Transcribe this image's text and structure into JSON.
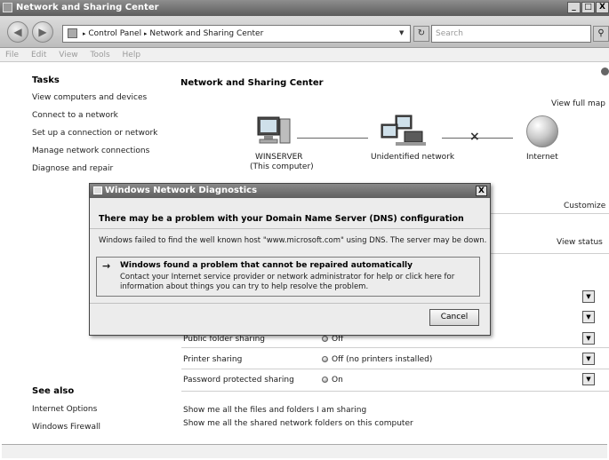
{
  "window": {
    "title": "Network and Sharing Center",
    "buttons": [
      "_",
      "□",
      "X"
    ]
  },
  "address": {
    "crumb_sep": "▸",
    "crumbs": [
      "Control Panel",
      "Network and Sharing Center"
    ],
    "search_placeholder": "Search",
    "search_icon": "magnifier-icon"
  },
  "menu": {
    "items": [
      "File",
      "Edit",
      "View",
      "Tools",
      "Help"
    ]
  },
  "sidebar": {
    "tasks_title": "Tasks",
    "tasks": [
      "View computers and devices",
      "Connect to a network",
      "Set up a connection or network",
      "Manage network connections",
      "Diagnose and repair"
    ],
    "see_also_title": "See also",
    "see_also": [
      "Internet Options",
      "Windows Firewall"
    ]
  },
  "main": {
    "title": "Network and Sharing Center",
    "view_full_map": "View full map",
    "map": {
      "computer_label": "WINSERVER",
      "computer_sub": "(This computer)",
      "network_label": "Unidentified network",
      "internet_label": "Internet",
      "broken_link": "×"
    },
    "customize": "Customize",
    "view_status": "View status",
    "sharing_rows": [
      {
        "label": "Public folder sharing",
        "value": "Off"
      },
      {
        "label": "Printer sharing",
        "value": "Off (no printers installed)"
      },
      {
        "label": "Password protected sharing",
        "value": "On"
      }
    ],
    "show_files": "Show me all the files and folders I am sharing",
    "show_folders": "Show me all the shared network folders on this computer"
  },
  "dialog": {
    "title": "Windows Network Diagnostics",
    "close": "X",
    "heading": "There may be a problem with your Domain Name Server (DNS) configuration",
    "message": "Windows failed to find the well known host \"www.microsoft.com\" using DNS. The server may be down.",
    "arrow": "→",
    "problem_title": "Windows found a problem that cannot be repaired automatically",
    "problem_line1": "Contact your Internet service provider or network administrator for help or click here for",
    "problem_line2": "information about things you can try to help resolve the problem.",
    "cancel": "Cancel"
  }
}
